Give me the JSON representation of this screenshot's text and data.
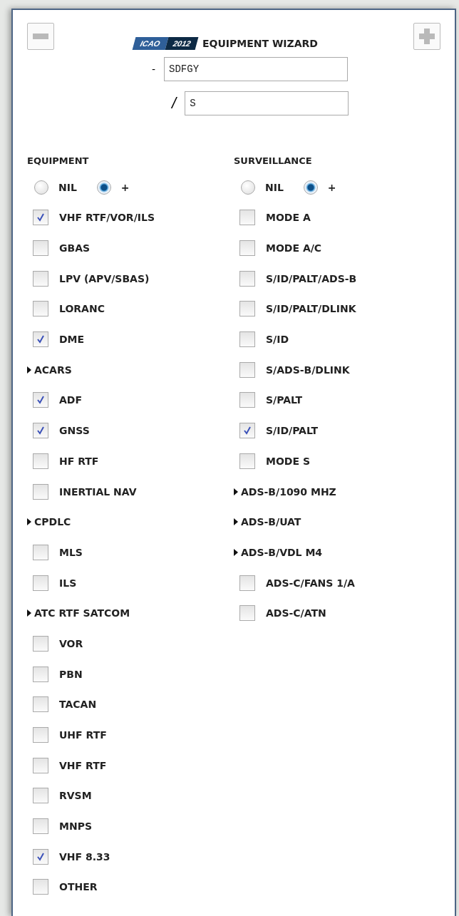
{
  "header": {
    "logo": [
      "ICAO",
      "2012"
    ],
    "title": "EQUIPMENT WIZARD"
  },
  "fields": [
    {
      "prefix": "-",
      "value": "SDFGY"
    },
    {
      "prefix": "/",
      "value": "S"
    }
  ],
  "columns": [
    {
      "heading": "EQUIPMENT",
      "radios": [
        {
          "label": "NIL",
          "selected": false
        },
        {
          "label": "+",
          "selected": true
        }
      ],
      "items": [
        {
          "kind": "checkbox",
          "label": "VHF RTF/VOR/ILS",
          "checked": true
        },
        {
          "kind": "checkbox",
          "label": "GBAS",
          "checked": false
        },
        {
          "kind": "checkbox",
          "label": "LPV (APV/SBAS)",
          "checked": false
        },
        {
          "kind": "checkbox",
          "label": "LORANC",
          "checked": false
        },
        {
          "kind": "checkbox",
          "label": "DME",
          "checked": true
        },
        {
          "kind": "expander",
          "label": "ACARS"
        },
        {
          "kind": "checkbox",
          "label": "ADF",
          "checked": true
        },
        {
          "kind": "checkbox",
          "label": "GNSS",
          "checked": true
        },
        {
          "kind": "checkbox",
          "label": "HF RTF",
          "checked": false
        },
        {
          "kind": "checkbox",
          "label": "INERTIAL NAV",
          "checked": false
        },
        {
          "kind": "expander",
          "label": "CPDLC"
        },
        {
          "kind": "checkbox",
          "label": "MLS",
          "checked": false
        },
        {
          "kind": "checkbox",
          "label": "ILS",
          "checked": false
        },
        {
          "kind": "expander",
          "label": "ATC RTF SATCOM"
        },
        {
          "kind": "checkbox",
          "label": "VOR",
          "checked": false
        },
        {
          "kind": "checkbox",
          "label": "PBN",
          "checked": false
        },
        {
          "kind": "checkbox",
          "label": "TACAN",
          "checked": false
        },
        {
          "kind": "checkbox",
          "label": "UHF RTF",
          "checked": false
        },
        {
          "kind": "checkbox",
          "label": "VHF RTF",
          "checked": false
        },
        {
          "kind": "checkbox",
          "label": "RVSM",
          "checked": false
        },
        {
          "kind": "checkbox",
          "label": "MNPS",
          "checked": false
        },
        {
          "kind": "checkbox",
          "label": "VHF 8.33",
          "checked": true
        },
        {
          "kind": "checkbox",
          "label": "OTHER",
          "checked": false
        }
      ]
    },
    {
      "heading": "SURVEILLANCE",
      "radios": [
        {
          "label": "NIL",
          "selected": false
        },
        {
          "label": "+",
          "selected": true
        }
      ],
      "items": [
        {
          "kind": "checkbox",
          "label": "MODE A",
          "checked": false
        },
        {
          "kind": "checkbox",
          "label": "MODE A/C",
          "checked": false
        },
        {
          "kind": "checkbox",
          "label": "S/ID/PALT/ADS-B",
          "checked": false
        },
        {
          "kind": "checkbox",
          "label": "S/ID/PALT/DLINK",
          "checked": false
        },
        {
          "kind": "checkbox",
          "label": "S/ID",
          "checked": false
        },
        {
          "kind": "checkbox",
          "label": "S/ADS-B/DLINK",
          "checked": false
        },
        {
          "kind": "checkbox",
          "label": "S/PALT",
          "checked": false
        },
        {
          "kind": "checkbox",
          "label": "S/ID/PALT",
          "checked": true
        },
        {
          "kind": "checkbox",
          "label": "MODE S",
          "checked": false
        },
        {
          "kind": "expander",
          "label": "ADS-B/1090 MHZ"
        },
        {
          "kind": "expander",
          "label": "ADS-B/UAT"
        },
        {
          "kind": "expander",
          "label": "ADS-B/VDL M4"
        },
        {
          "kind": "checkbox",
          "label": "ADS-C/FANS 1/A",
          "checked": false
        },
        {
          "kind": "checkbox",
          "label": "ADS-C/ATN",
          "checked": false
        }
      ]
    }
  ]
}
